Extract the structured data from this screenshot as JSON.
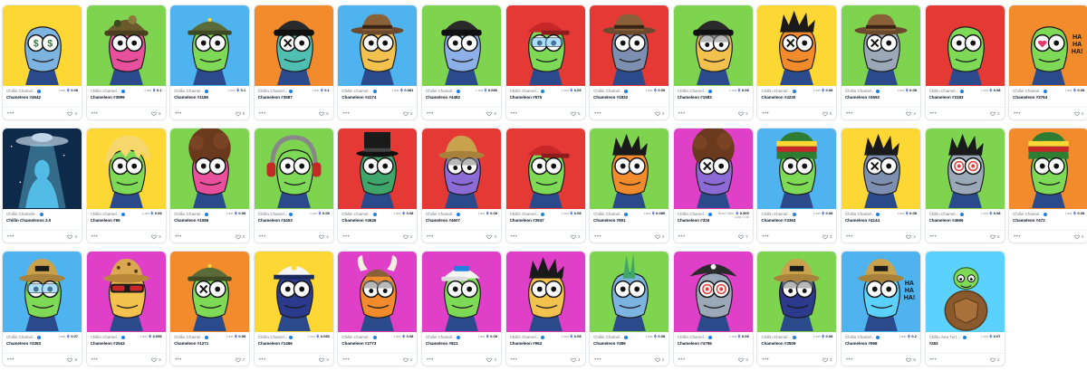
{
  "cards": [
    {
      "collection": "Chillin Chamel...",
      "name": "Chameleon #4642",
      "price_label": "Last",
      "price": "0.08",
      "favorites": "3",
      "bg": "#fdd835",
      "skin": "#7db3e0",
      "eyes": "dollar",
      "hat": "none"
    },
    {
      "collection": "Chillin Chamel...",
      "name": "Chameleon #3999",
      "price_label": "Last",
      "price": "0.1",
      "favorites": "6",
      "bg": "#7fd44f",
      "skin": "#e84f9c",
      "eyes": "round",
      "hat": "beanie-camo"
    },
    {
      "collection": "Chillin Chamel...",
      "name": "Chameleon #1186",
      "price_label": "Last",
      "price": "0.1",
      "favorites": "5",
      "bg": "#4fb3f0",
      "skin": "#7ed957",
      "eyes": "round",
      "hat": "army"
    },
    {
      "collection": "Chillin Chamel...",
      "name": "Chameleon #3587",
      "price_label": "Last",
      "price": "0.1",
      "favorites": "6",
      "bg": "#f28b2c",
      "skin": "#4fbfb1",
      "eyes": "x",
      "hat": "beanie-black"
    },
    {
      "collection": "Chillin Chamel...",
      "name": "Chameleon #4174",
      "price_label": "Last",
      "price": "0.081",
      "favorites": "3",
      "bg": "#4fb3f0",
      "skin": "#f2c14e",
      "eyes": "round",
      "hat": "fedora"
    },
    {
      "collection": "Chillin Chamel...",
      "name": "Chameleon #4482",
      "price_label": "Last",
      "price": "0.086",
      "favorites": "6",
      "bg": "#7fd44f",
      "skin": "#8db0e8",
      "eyes": "round",
      "hat": "beanie-black"
    },
    {
      "collection": "Chillin Chamel...",
      "name": "Chameleon #575",
      "price_label": "Last",
      "price": "0.09",
      "favorites": "5",
      "bg": "#e53935",
      "skin": "#7ed957",
      "eyes": "glasses",
      "hat": "cap"
    },
    {
      "collection": "Chillin Chamel...",
      "name": "Chameleon #1832",
      "price_label": "Last",
      "price": "0.09",
      "favorites": "3",
      "bg": "#e53935",
      "skin": "#7d8fb0",
      "eyes": "round",
      "hat": "fedora"
    },
    {
      "collection": "Chillin Chamel...",
      "name": "Chameleon #1583",
      "price_label": "Last",
      "price": "0.08",
      "favorites": "2",
      "bg": "#7fd44f",
      "skin": "#f2c14e",
      "eyes": "sleepy",
      "hat": "beanie-black"
    },
    {
      "collection": "Chillin Chamel...",
      "name": "Chameleon #4230",
      "price_label": "Last",
      "price": "0.08",
      "favorites": "5",
      "bg": "#fdd835",
      "skin": "#f28b2c",
      "eyes": "x",
      "hat": "spiky"
    },
    {
      "collection": "Chillin Chamel...",
      "name": "Chameleon #4692",
      "price_label": "Last",
      "price": "0.08",
      "favorites": "2",
      "bg": "#7fd44f",
      "skin": "#9aa8b8",
      "eyes": "x",
      "hat": "fedora"
    },
    {
      "collection": "Chillin Chamel...",
      "name": "Chameleon #3183",
      "price_label": "Last",
      "price": "0.08",
      "favorites": "3",
      "bg": "#e53935",
      "skin": "#7ed957",
      "eyes": "round",
      "hat": "none"
    },
    {
      "collection": "Chillin Chamel...",
      "name": "Chameleon #3764",
      "price_label": "Last",
      "price": "0.08",
      "favorites": "2",
      "bg": "#f28b2c",
      "skin": "#7ed957",
      "eyes": "heart",
      "hat": "none",
      "overlay": "HA HA HA!"
    },
    {
      "collection": "Chillin Chamele...",
      "name": "Chillin Chameleons 3.0",
      "price_label": "",
      "price": "",
      "favorites": "3",
      "bg": "#0d2a4a",
      "skin": "#5ad1ff",
      "eyes": "none",
      "hat": "ufo"
    },
    {
      "collection": "Chillin Chamel...",
      "name": "Chameleon #96",
      "price_label": "Last",
      "price": "0.08",
      "favorites": "3",
      "bg": "#fdd835",
      "skin": "#7ed957",
      "eyes": "round",
      "hat": "blonde"
    },
    {
      "collection": "Chillin Chamel...",
      "name": "Chameleon #1086",
      "price_label": "Last",
      "price": "0.08",
      "favorites": "3",
      "bg": "#7fd44f",
      "skin": "#e84f9c",
      "eyes": "round",
      "hat": "afro"
    },
    {
      "collection": "Chillin Chamel...",
      "name": "Chameleon #4403",
      "price_label": "Last",
      "price": "0.08",
      "favorites": "2",
      "bg": "#7fd44f",
      "skin": "#7ed957",
      "eyes": "round",
      "hat": "headphones"
    },
    {
      "collection": "Chillin Chamel...",
      "name": "Chameleon #4626",
      "price_label": "Last",
      "price": "0.08",
      "favorites": "2",
      "bg": "#e53935",
      "skin": "#3fa66b",
      "eyes": "round",
      "hat": "tophat"
    },
    {
      "collection": "Chillin Chamel...",
      "name": "Chameleon #4607",
      "price_label": "Last",
      "price": "0.08",
      "favorites": "3",
      "bg": "#e53935",
      "skin": "#8c6bd6",
      "eyes": "sleepy",
      "hat": "bucket"
    },
    {
      "collection": "Chillin Chamel...",
      "name": "Chameleon #3947",
      "price_label": "Last",
      "price": "0.08",
      "favorites": "3",
      "bg": "#e53935",
      "skin": "#7ed957",
      "eyes": "round",
      "hat": "cap"
    },
    {
      "collection": "Chillin Chamel...",
      "name": "Chameleon #901",
      "price_label": "Last",
      "price": "0.089",
      "favorites": "3",
      "bg": "#7fd44f",
      "skin": "#f28b2c",
      "eyes": "round",
      "hat": "spiky"
    },
    {
      "collection": "Chillin Chamel...",
      "name": "Chameleon #318",
      "price_label": "Best Offer",
      "price": "0.009",
      "sub": "Last 0.08",
      "favorites": "7",
      "bg": "#e040c8",
      "skin": "#8c6bd6",
      "eyes": "x",
      "hat": "afro"
    },
    {
      "collection": "Chillin Chamel...",
      "name": "Chameleon #3363",
      "price_label": "Last",
      "price": "0.08",
      "favorites": "3",
      "bg": "#4fb3f0",
      "skin": "#7ed957",
      "eyes": "round",
      "hat": "rasta"
    },
    {
      "collection": "Chillin Chamel...",
      "name": "Chameleon #4144",
      "price_label": "Last",
      "price": "0.08",
      "favorites": "2",
      "bg": "#fdd835",
      "skin": "#7d8fb0",
      "eyes": "x",
      "hat": "spiky"
    },
    {
      "collection": "Chillin Chamel...",
      "name": "Chameleon #4666",
      "price_label": "Last",
      "price": "0.08",
      "favorites": "5",
      "bg": "#7fd44f",
      "skin": "#9aa8b8",
      "eyes": "spiral",
      "hat": "spiky"
    },
    {
      "collection": "Chillin Chamel...",
      "name": "Chameleon #472",
      "price_label": "Last",
      "price": "0.08",
      "favorites": "3",
      "bg": "#f28b2c",
      "skin": "#7ed957",
      "eyes": "round",
      "hat": "rasta"
    },
    {
      "collection": "Chillin Chamel...",
      "name": "Chameleon #3393",
      "price_label": "Last",
      "price": "0.07",
      "favorites": "6",
      "bg": "#4fb3f0",
      "skin": "#7ed957",
      "eyes": "glasses",
      "hat": "bucket-tan"
    },
    {
      "collection": "Chillin Chamel...",
      "name": "Chameleon #2543",
      "price_label": "Last",
      "price": "0.098",
      "favorites": "3",
      "bg": "#e040c8",
      "skin": "#f2c14e",
      "eyes": "sunglasses",
      "hat": "bucket-leopard"
    },
    {
      "collection": "Chillin Chamel...",
      "name": "Chameleon #1271",
      "price_label": "Last",
      "price": "0.08",
      "favorites": "7",
      "bg": "#f28b2c",
      "skin": "#7ed957",
      "eyes": "x",
      "hat": "army"
    },
    {
      "collection": "Chillin Chamel...",
      "name": "Chameleon #1466",
      "price_label": "Last",
      "price": "0.083",
      "favorites": "3",
      "bg": "#fdd835",
      "skin": "#2b3a8c",
      "eyes": "round",
      "hat": "captain"
    },
    {
      "collection": "Chillin Chamel...",
      "name": "Chameleon #2773",
      "price_label": "Last",
      "price": "0.08",
      "favorites": "2",
      "bg": "#e040c8",
      "skin": "#f28b2c",
      "eyes": "sleepy",
      "hat": "horns"
    },
    {
      "collection": "Chillin Chamel...",
      "name": "Chameleon #821",
      "price_label": "Last",
      "price": "0.08",
      "favorites": "2",
      "bg": "#e040c8",
      "skin": "#7ed957",
      "eyes": "round",
      "hat": "cap-white"
    },
    {
      "collection": "Chillin Chamel...",
      "name": "Chameleon #953",
      "price_label": "Last",
      "price": "0.08",
      "favorites": "4",
      "bg": "#e040c8",
      "skin": "#f2c14e",
      "eyes": "round",
      "hat": "spiky"
    },
    {
      "collection": "Chillin Chamel...",
      "name": "Chameleon #389",
      "price_label": "Last",
      "price": "0.08",
      "favorites": "2",
      "bg": "#7fd44f",
      "skin": "#7db3e0",
      "eyes": "round",
      "hat": "mohawk"
    },
    {
      "collection": "Chillin Chamel...",
      "name": "Chameleon #4795",
      "price_label": "Last",
      "price": "0.08",
      "favorites": "3",
      "bg": "#e040c8",
      "skin": "#9aa8b8",
      "eyes": "spiral",
      "hat": "pirate"
    },
    {
      "collection": "Chillin Chamel...",
      "name": "Chameleon #3509",
      "price_label": "Last",
      "price": "0.08",
      "favorites": "3",
      "bg": "#7fd44f",
      "skin": "#2b3a8c",
      "eyes": "sleepy",
      "hat": "bucket-tan"
    },
    {
      "collection": "Chillin Chamel...",
      "name": "Chameleon #968",
      "price_label": "Last",
      "price": "0.2",
      "favorites": "5",
      "bg": "#4fb3f0",
      "skin": "#5ad1ff",
      "eyes": "round",
      "hat": "bucket-tan",
      "overlay": "HA HA HA!"
    },
    {
      "collection": "Chillin Sea Turtles",
      "name": "#283",
      "price_label": "Last",
      "price": "0.07",
      "favorites": "2",
      "bg": "#5ad1ff",
      "skin": "#7ed957",
      "eyes": "turtle",
      "hat": "turtle"
    }
  ]
}
